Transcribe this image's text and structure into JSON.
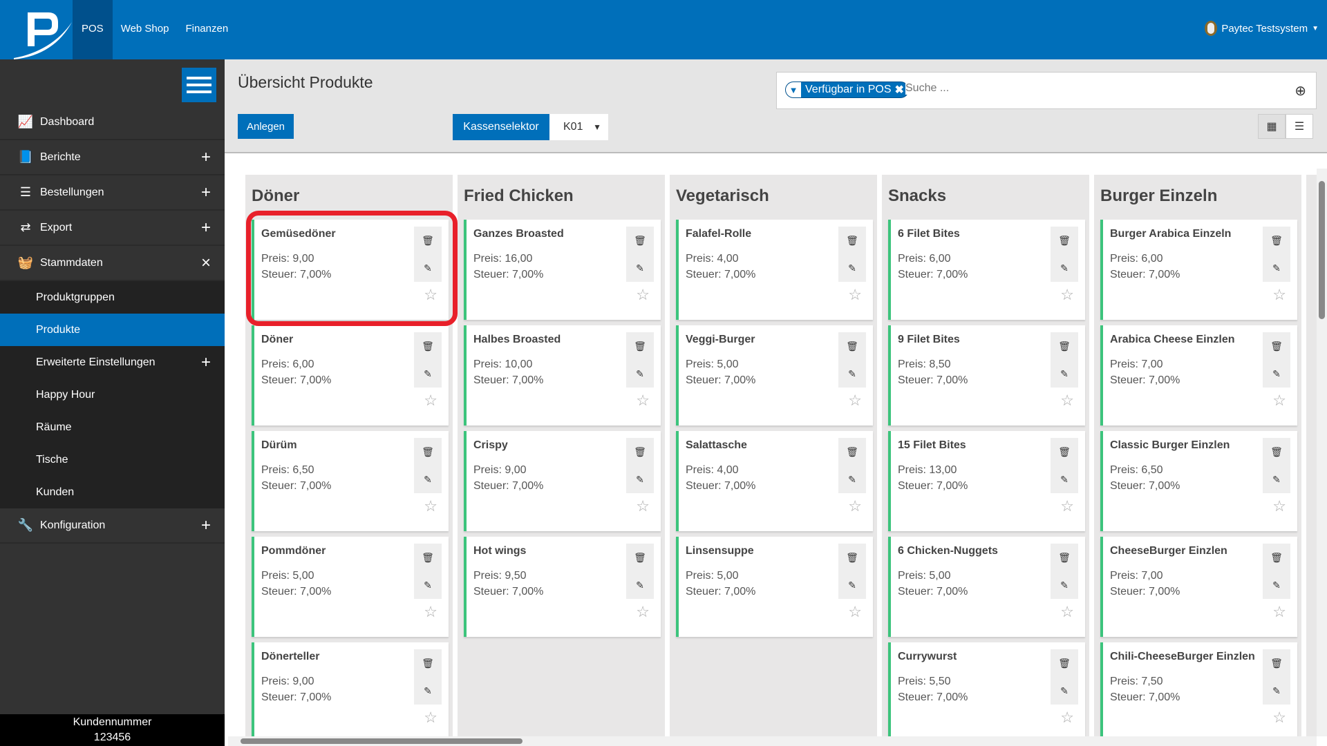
{
  "header": {
    "nav": [
      "POS",
      "Web Shop",
      "Finanzen"
    ],
    "active_nav": "POS",
    "user": "Paytec Testsystem"
  },
  "sidebar": {
    "items": [
      {
        "label": "Dashboard",
        "icon": "chart-line-icon",
        "toggle": ""
      },
      {
        "label": "Berichte",
        "icon": "book-icon",
        "toggle": "+"
      },
      {
        "label": "Bestellungen",
        "icon": "list-icon",
        "toggle": "+"
      },
      {
        "label": "Export",
        "icon": "exchange-icon",
        "toggle": "+"
      },
      {
        "label": "Stammdaten",
        "icon": "basket-icon",
        "toggle": "×"
      }
    ],
    "subitems": [
      {
        "label": "Produktgruppen",
        "toggle": ""
      },
      {
        "label": "Produkte",
        "toggle": "",
        "active": true
      },
      {
        "label": "Erweiterte Einstellungen",
        "toggle": "+"
      },
      {
        "label": "Happy Hour",
        "toggle": ""
      },
      {
        "label": "Räume",
        "toggle": ""
      },
      {
        "label": "Tische",
        "toggle": ""
      },
      {
        "label": "Kunden",
        "toggle": ""
      }
    ],
    "after": [
      {
        "label": "Konfiguration",
        "icon": "wrench-icon",
        "toggle": "+"
      }
    ],
    "footer_label": "Kundennummer",
    "footer_value": "123456"
  },
  "page": {
    "title": "Übersicht Produkte",
    "create_label": "Anlegen",
    "kassenselektor_label": "Kassenselektor",
    "kasse_value": "K01",
    "filter_chip": "Verfügbar in POS",
    "search_placeholder": "Suche ...",
    "view_mode": "grid"
  },
  "colors": {
    "brand": "#006fba",
    "highlight": "#e8202a",
    "available": "#3cc47c"
  },
  "columns": [
    {
      "title": "Döner",
      "products": [
        {
          "name": "Gemüsedöner",
          "price": "Preis: 9,00",
          "tax": "Steuer: 7,00%"
        },
        {
          "name": "Döner",
          "price": "Preis: 6,00",
          "tax": "Steuer: 7,00%"
        },
        {
          "name": "Dürüm",
          "price": "Preis: 6,50",
          "tax": "Steuer: 7,00%"
        },
        {
          "name": "Pommdöner",
          "price": "Preis: 5,00",
          "tax": "Steuer: 7,00%"
        },
        {
          "name": "Dönerteller",
          "price": "Preis: 9,00",
          "tax": "Steuer: 7,00%"
        }
      ]
    },
    {
      "title": "Fried Chicken",
      "products": [
        {
          "name": "Ganzes Broasted",
          "price": "Preis: 16,00",
          "tax": "Steuer: 7,00%"
        },
        {
          "name": "Halbes Broasted",
          "price": "Preis: 10,00",
          "tax": "Steuer: 7,00%"
        },
        {
          "name": "Crispy",
          "price": "Preis: 9,00",
          "tax": "Steuer: 7,00%"
        },
        {
          "name": "Hot wings",
          "price": "Preis: 9,50",
          "tax": "Steuer: 7,00%"
        }
      ]
    },
    {
      "title": "Vegetarisch",
      "products": [
        {
          "name": "Falafel-Rolle",
          "price": "Preis: 4,00",
          "tax": "Steuer: 7,00%"
        },
        {
          "name": "Veggi-Burger",
          "price": "Preis: 5,00",
          "tax": "Steuer: 7,00%"
        },
        {
          "name": "Salattasche",
          "price": "Preis: 4,00",
          "tax": "Steuer: 7,00%"
        },
        {
          "name": "Linsensuppe",
          "price": "Preis: 5,00",
          "tax": "Steuer: 7,00%"
        }
      ]
    },
    {
      "title": "Snacks",
      "products": [
        {
          "name": "6 Filet Bites",
          "price": "Preis: 6,00",
          "tax": "Steuer: 7,00%"
        },
        {
          "name": "9 Filet Bites",
          "price": "Preis: 8,50",
          "tax": "Steuer: 7,00%"
        },
        {
          "name": "15 Filet Bites",
          "price": "Preis: 13,00",
          "tax": "Steuer: 7,00%"
        },
        {
          "name": "6 Chicken-Nuggets",
          "price": "Preis: 5,00",
          "tax": "Steuer: 7,00%"
        },
        {
          "name": "Currywurst",
          "price": "Preis: 5,50",
          "tax": "Steuer: 7,00%"
        }
      ]
    },
    {
      "title": "Burger Einzeln",
      "products": [
        {
          "name": "Burger Arabica Einzeln",
          "price": "Preis: 6,00",
          "tax": "Steuer: 7,00%"
        },
        {
          "name": "Arabica Cheese Einzlen",
          "price": "Preis: 7,00",
          "tax": "Steuer: 7,00%"
        },
        {
          "name": "Classic Burger Einzlen",
          "price": "Preis: 6,50",
          "tax": "Steuer: 7,00%"
        },
        {
          "name": "CheeseBurger Einzlen",
          "price": "Preis: 7,00",
          "tax": "Steuer: 7,00%"
        },
        {
          "name": "Chili-CheeseBurger Einzlen",
          "price": "Preis: 7,50",
          "tax": "Steuer: 7,00%"
        }
      ]
    }
  ]
}
